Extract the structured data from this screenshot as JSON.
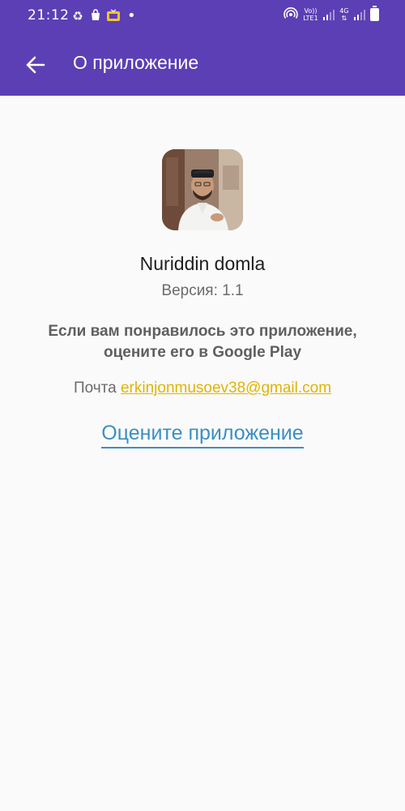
{
  "status_bar": {
    "time": "21:12",
    "left_icons": [
      "recycle-icon",
      "bag-icon",
      "tv-icon"
    ],
    "dot": "•",
    "volte_label_1": "Vo))",
    "volte_label_2": "LTE1",
    "network_label": "4G"
  },
  "app_bar": {
    "title": "О приложение",
    "background_color": "#5c3fb5"
  },
  "about": {
    "app_name": "Nuriddin domla",
    "version_label": "Версия:",
    "version_value": "1.1",
    "rate_message": "Если вам понравилось это приложение, оцените его в Google Play",
    "email_label": "Почта",
    "email": "erkinjonmusoev38@gmail.com",
    "rate_link": "Оцените приложение"
  },
  "colors": {
    "accent": "#5c3fb5",
    "email": "#e0b400",
    "link": "#3b8fc4"
  }
}
